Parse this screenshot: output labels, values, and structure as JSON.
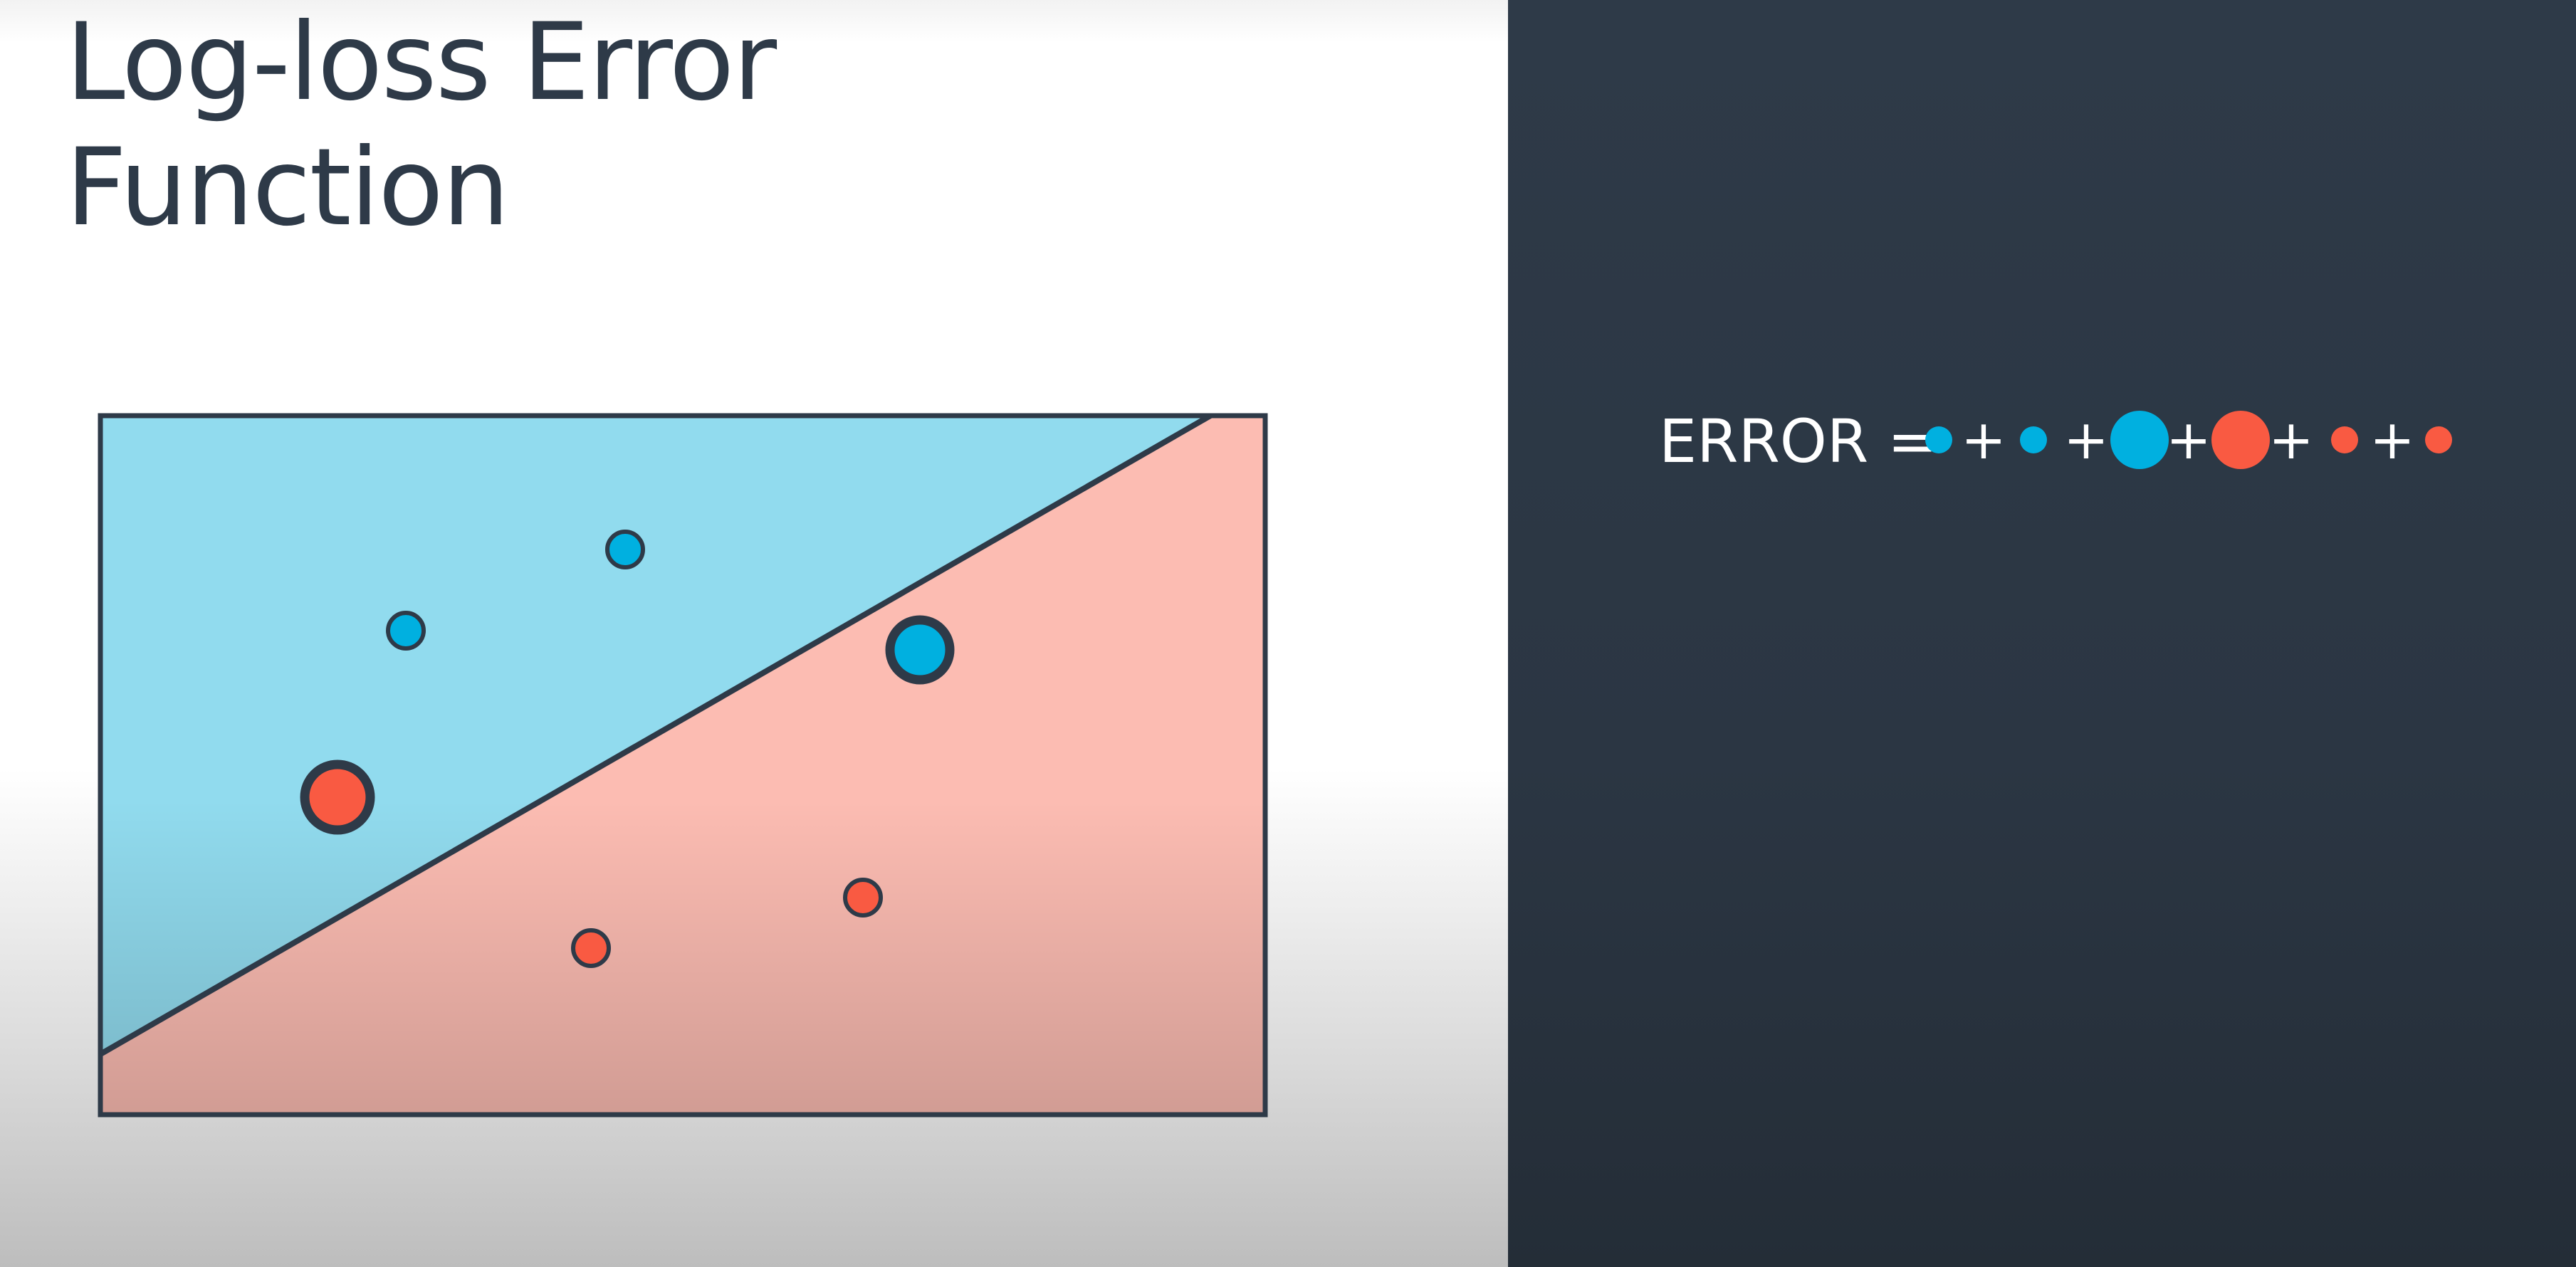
{
  "title": {
    "line1": "Log-loss Error",
    "line2": "Function"
  },
  "equation": {
    "label": "ERROR =",
    "operator": "+",
    "terms": [
      {
        "color": "#00b0e0",
        "size": "small"
      },
      {
        "color": "#00b0e0",
        "size": "small"
      },
      {
        "color": "#00b0e0",
        "size": "large"
      },
      {
        "color": "#f95a42",
        "size": "large"
      },
      {
        "color": "#f95a42",
        "size": "small"
      },
      {
        "color": "#f95a42",
        "size": "small"
      }
    ]
  },
  "colors": {
    "blue_point": "#00b0e0",
    "red_point": "#f95a42",
    "blue_region": "#91dbee",
    "red_region": "#fcbcb2",
    "outline": "#2e3a48",
    "dark_panel": "#2e3a48"
  },
  "points": [
    {
      "class": "blue",
      "misclassified": false
    },
    {
      "class": "blue",
      "misclassified": false
    },
    {
      "class": "blue",
      "misclassified": true
    },
    {
      "class": "red",
      "misclassified": true
    },
    {
      "class": "red",
      "misclassified": false
    },
    {
      "class": "red",
      "misclassified": false
    }
  ]
}
